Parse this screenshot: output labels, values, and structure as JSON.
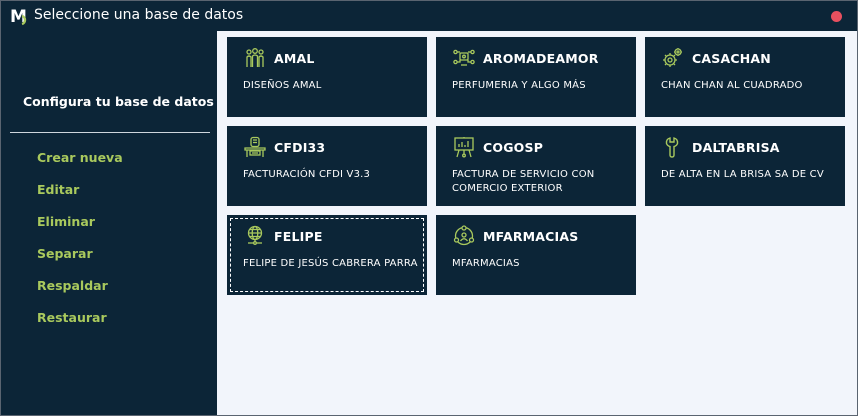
{
  "window": {
    "title": "Seleccione una base de datos",
    "logo": "M"
  },
  "sidebar": {
    "heading": "Configura tu base de datos",
    "items": [
      "Crear nueva",
      "Editar",
      "Eliminar",
      "Separar",
      "Respaldar",
      "Restaurar"
    ]
  },
  "colors": {
    "dark": "#0c2537",
    "accent": "#a9c95d",
    "background": "#f2f5fb",
    "close": "#e8505f"
  },
  "databases": [
    {
      "name": "AMAL",
      "description": "DISEÑOS AMAL",
      "icon": "people-icon"
    },
    {
      "name": "AROMADEAMOR",
      "description": "PERFUMERIA Y ALGO MÁS",
      "icon": "network-icon"
    },
    {
      "name": "CASACHAN",
      "description": "CHAN CHAN AL CUADRADO",
      "icon": "gears-icon"
    },
    {
      "name": "CFDI33",
      "description": "FACTURACIÓN CFDI V3.3",
      "icon": "office-desk-icon"
    },
    {
      "name": "COGOSP",
      "description": "FACTURA DE SERVICIO CON COMERCIO EXTERIOR",
      "icon": "presentation-icon"
    },
    {
      "name": "DALTABRISA",
      "description": "DE ALTA EN LA BRISA SA DE CV",
      "icon": "wrench-icon"
    },
    {
      "name": "FELIPE",
      "description": "FELIPE DE JESÚS CABRERA PARRA",
      "icon": "globe-icon",
      "selected": true
    },
    {
      "name": "MFARMACIAS",
      "description": "MFARMACIAS",
      "icon": "team-circle-icon"
    }
  ]
}
